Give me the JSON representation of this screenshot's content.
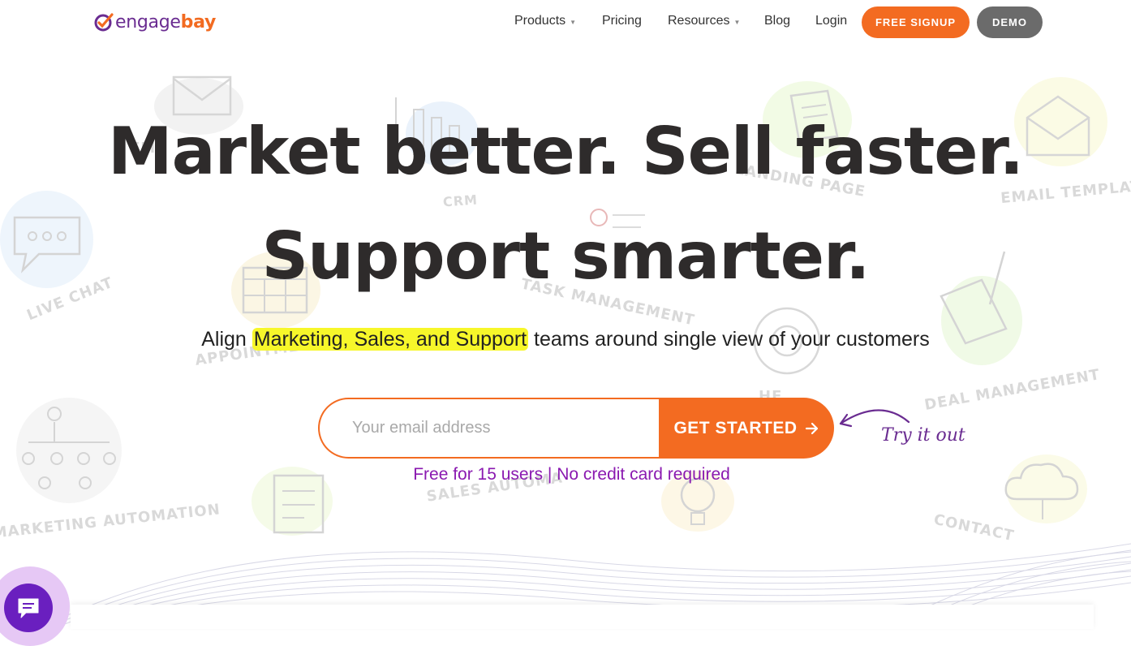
{
  "brand": {
    "name_part1": "engage",
    "name_part2": "bay",
    "accent": "#f36b21",
    "purple": "#6a2c91"
  },
  "nav": {
    "products": "Products",
    "pricing": "Pricing",
    "resources": "Resources",
    "blog": "Blog",
    "login": "Login",
    "free_signup": "FREE SIGNUP",
    "demo": "DEMO"
  },
  "background_labels": {
    "email": "EM",
    "crm": "CRM",
    "landing_page": "LANDING PAGE",
    "email_template": "EMAIL TEMPLATE",
    "live_chat": "LIVE CHAT",
    "task_management": "TASK MANAGEMENT",
    "appointment": "APPOINTME",
    "deal_management": "DEAL MANAGEMENT",
    "marketing_automation": "MARKETING AUTOMATION",
    "sales_automation": "SALES AUTOMA",
    "contact": "CONTACT",
    "help": "HE"
  },
  "hero": {
    "line1": "Market better. Sell faster.",
    "line2": "Support smarter.",
    "sub_prefix": "Align ",
    "sub_highlight": "Marketing, Sales, and Support",
    "sub_suffix": " teams around single view of your customers"
  },
  "signup_form": {
    "email_placeholder": "Your email address",
    "email_value": "",
    "button_label": "GET STARTED",
    "try_label": "Try it out",
    "note": "Free for 15 users | No credit card required"
  },
  "icons": {
    "logo": "engagebay-logo-icon",
    "caret": "chevron-down-icon",
    "arrow": "arrow-right-icon",
    "chat": "chat-bubble-icon"
  }
}
